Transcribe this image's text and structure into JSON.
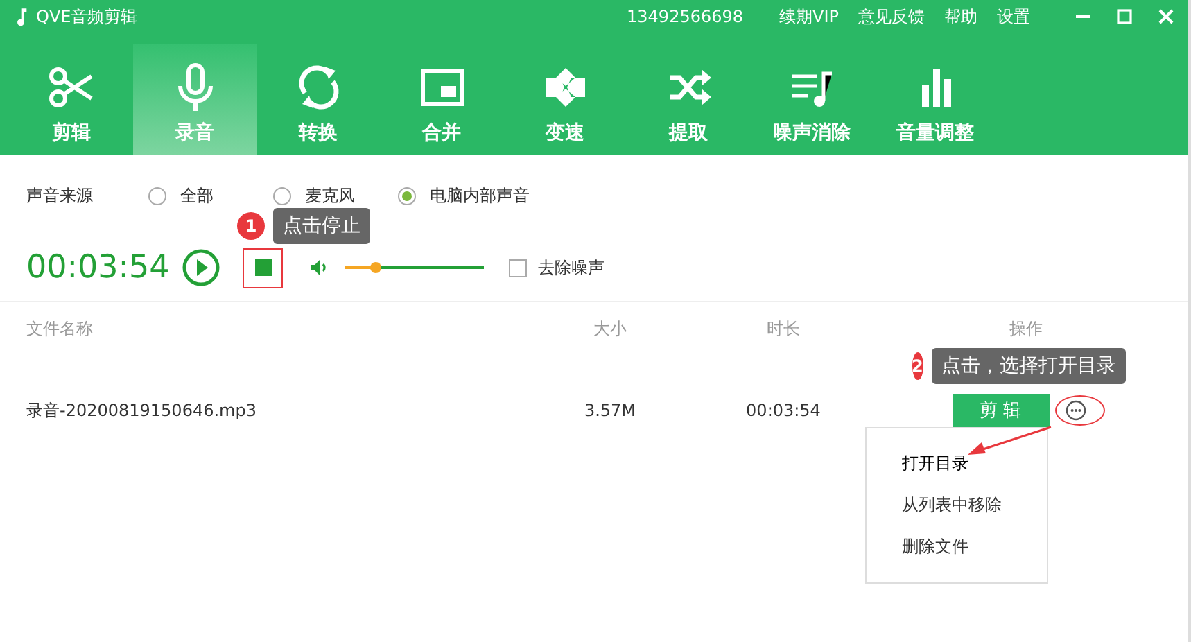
{
  "window": {
    "title": "QVE音频剪辑",
    "phone": "13492566698",
    "links": [
      "续期VIP",
      "意见反馈",
      "帮助",
      "设置"
    ]
  },
  "tabs": [
    {
      "label": "剪辑",
      "selected": false
    },
    {
      "label": "录音",
      "selected": true
    },
    {
      "label": "转换",
      "selected": false
    },
    {
      "label": "合并",
      "selected": false
    },
    {
      "label": "变速",
      "selected": false
    },
    {
      "label": "提取",
      "selected": false
    },
    {
      "label": "噪声消除",
      "selected": false
    },
    {
      "label": "音量调整",
      "selected": false
    }
  ],
  "source": {
    "label": "声音来源",
    "options": [
      {
        "label": "全部",
        "selected": false
      },
      {
        "label": "麦克风",
        "selected": false
      },
      {
        "label": "电脑内部声音",
        "selected": true
      }
    ]
  },
  "recorder": {
    "time": "00:03:54",
    "volume": {
      "level": 0.22
    },
    "denoise": {
      "label": "去除噪声",
      "checked": false
    }
  },
  "table": {
    "columns": [
      "文件名称",
      "大小",
      "时长",
      "操作"
    ],
    "rows": [
      {
        "name": "录音-20200819150646.mp3",
        "size": "3.57M",
        "duration": "00:03:54",
        "action": "剪 辑"
      }
    ]
  },
  "menu": [
    {
      "label": "打开目录",
      "highlighted": true
    },
    {
      "label": "从列表中移除",
      "highlighted": false
    },
    {
      "label": "删除文件",
      "highlighted": false
    }
  ],
  "callouts": [
    {
      "number": "1",
      "text": "点击停止"
    },
    {
      "number": "2",
      "text": "点击，选择打开目录"
    }
  ]
}
